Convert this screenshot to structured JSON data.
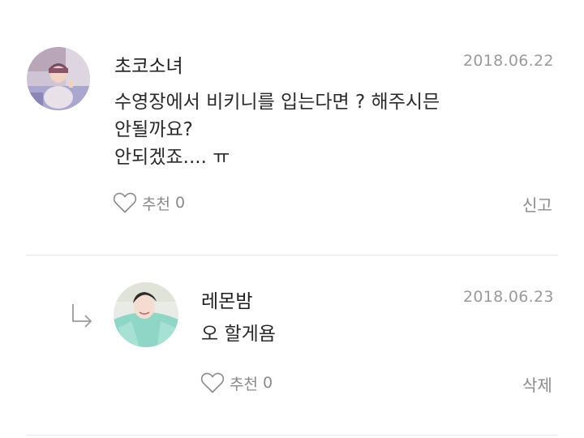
{
  "comments": [
    {
      "username": "초코소녀",
      "date": "2018.06.22",
      "lines": [
        "수영장에서 비키니를 입는다면 ? 해주시믄",
        "안될까요?",
        "안되겠죠.... ㅠ"
      ],
      "like_label": "추천",
      "like_count": "0",
      "action_label": "신고"
    },
    {
      "username": "레몬밤",
      "date": "2018.06.23",
      "lines": [
        "오 할게욤"
      ],
      "like_label": "추천",
      "like_count": "0",
      "action_label": "삭제"
    }
  ],
  "icons": {
    "heart": "heart-outline-icon",
    "reply": "reply-arrow-icon"
  },
  "colors": {
    "text": "#222222",
    "meta": "#9a9a9a",
    "divider": "#e6e6e6"
  }
}
